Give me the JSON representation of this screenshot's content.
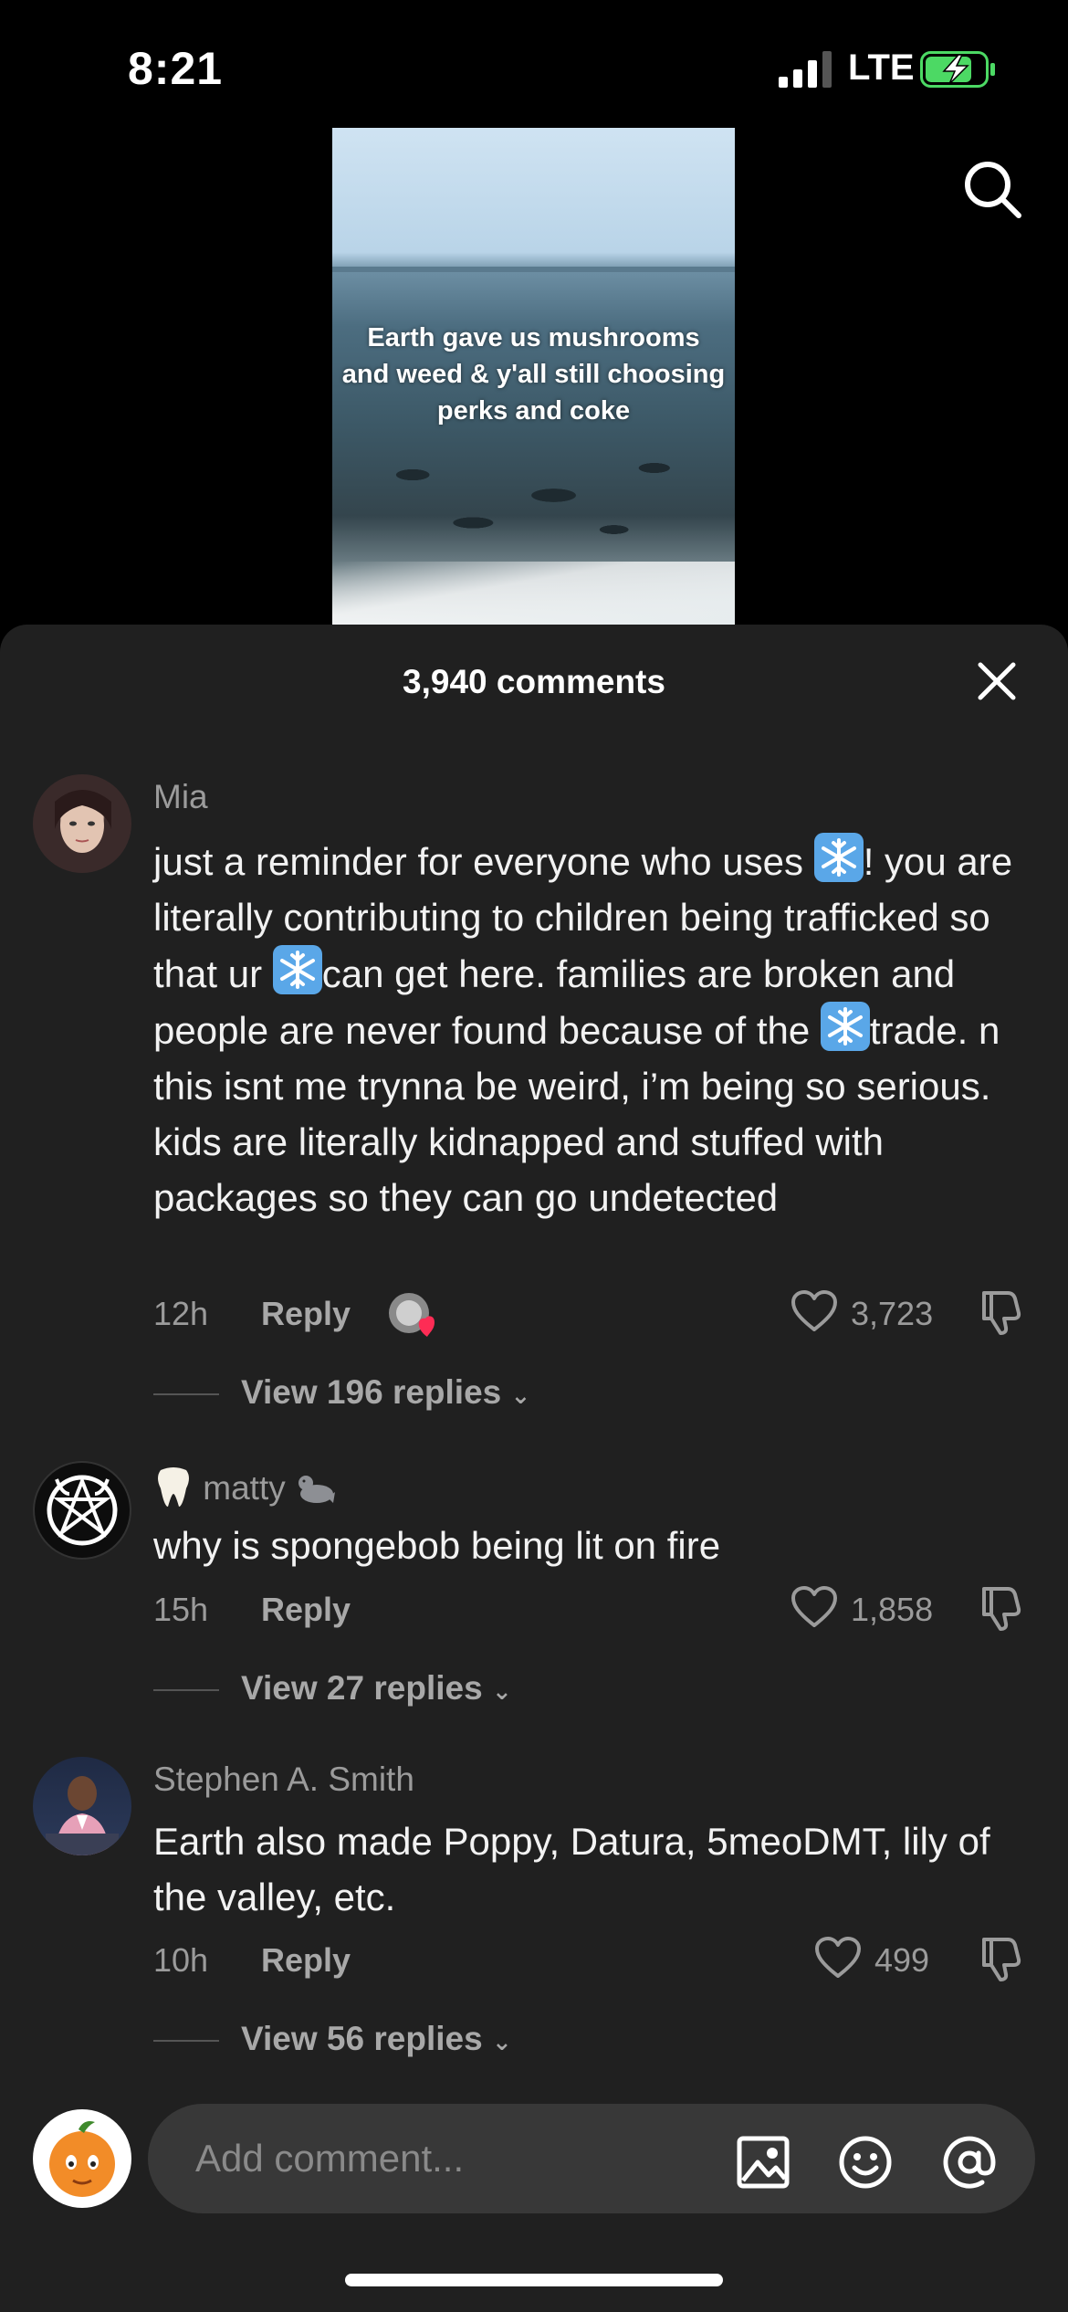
{
  "status_bar": {
    "time": "8:21",
    "network": "LTE",
    "signal_bars": 3,
    "battery_charging": true
  },
  "video": {
    "caption": "Earth gave us mushrooms and weed & y'all still choosing perks and coke"
  },
  "sheet": {
    "title": "3,940 comments"
  },
  "comments": [
    {
      "username": "Mia",
      "text_parts": [
        "just a reminder for everyone who uses ",
        "!",
        "you are literally contributing to children being trafficked so that ur ",
        "can get here. families are broken and people are never found because of the ",
        "trade. n this isnt me trynna be weird, i’m being so serious. kids are literally kidnapped and stuffed with packages so they can go undetected"
      ],
      "time_ago": "12h",
      "reply_label": "Reply",
      "likes": "3,723",
      "view_replies": "View 196 replies"
    },
    {
      "username": "matty",
      "text": "why is spongebob being lit on fire",
      "time_ago": "15h",
      "reply_label": "Reply",
      "likes": "1,858",
      "view_replies": "View 27 replies"
    },
    {
      "username": "Stephen A. Smith",
      "text": "Earth also made Poppy, Datura, 5meoDMT, lily of the valley, etc.",
      "time_ago": "10h",
      "reply_label": "Reply",
      "likes": "499",
      "view_replies": "View 56 replies"
    }
  ],
  "input": {
    "placeholder": "Add comment..."
  },
  "icons": {
    "search": "search-icon",
    "close": "close-icon",
    "heart": "heart-icon",
    "dislike": "dislike-icon",
    "image": "image-icon",
    "emoji": "emoji-icon",
    "mention": "at-icon",
    "snowflake": "snowflake-icon"
  },
  "colors": {
    "background": "#000000",
    "sheet": "#202020",
    "secondary_text": "#9b9b9b",
    "heart_red": "#fe2c55"
  }
}
